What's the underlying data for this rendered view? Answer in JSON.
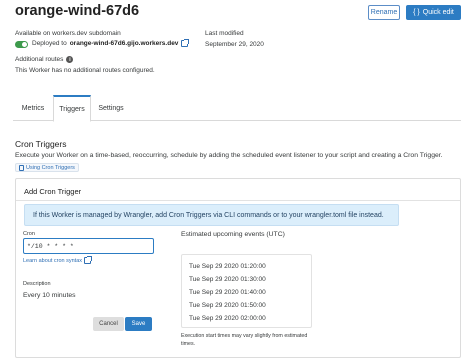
{
  "header": {
    "worker_name": "orange-wind-67d6",
    "rename_label": "Rename",
    "quick_edit_icon": "{ }",
    "quick_edit_label": "Quick edit"
  },
  "subdomain": {
    "label": "Available on workers.dev subdomain",
    "deployed_prefix": "Deployed to",
    "deployed_host": "orange-wind-67d6.gijo.workers.dev",
    "toggle_on": true
  },
  "last_modified": {
    "label": "Last modified",
    "value": "September 29, 2020"
  },
  "routes": {
    "label": "Additional routes",
    "info_glyph": "i",
    "text": "This Worker has no additional routes configured."
  },
  "tabs": [
    {
      "label": "Metrics",
      "active": false
    },
    {
      "label": "Triggers",
      "active": true
    },
    {
      "label": "Settings",
      "active": false
    }
  ],
  "cron": {
    "section_title": "Cron Triggers",
    "description": "Execute your Worker on a time-based, reoccurring, schedule by adding the scheduled event listener to your script and creating a Cron Trigger.",
    "doc_link": "Using Cron Triggers"
  },
  "add_trigger": {
    "title": "Add Cron Trigger",
    "notice": "If this Worker is managed by Wrangler, add Cron Triggers via CLI commands or to your wrangler.toml file instead.",
    "cron_label": "Cron",
    "cron_value": "*/10 * * * *",
    "syntax_link": "Learn about cron syntax",
    "description_label": "Description",
    "description_value": "Every 10 minutes",
    "cancel_label": "Cancel",
    "save_label": "Save"
  },
  "events": {
    "title": "Estimated upcoming events (UTC)",
    "items": [
      "Tue Sep 29 2020 01:20:00",
      "Tue Sep 29 2020 01:30:00",
      "Tue Sep 29 2020 01:40:00",
      "Tue Sep 29 2020 01:50:00",
      "Tue Sep 29 2020 02:00:00"
    ],
    "note": "Execution start times may vary slightly from estimated times."
  },
  "colors": {
    "accent": "#2c7cc3",
    "toggle": "#3d9a4c",
    "notice_bg": "#dbeefb"
  }
}
